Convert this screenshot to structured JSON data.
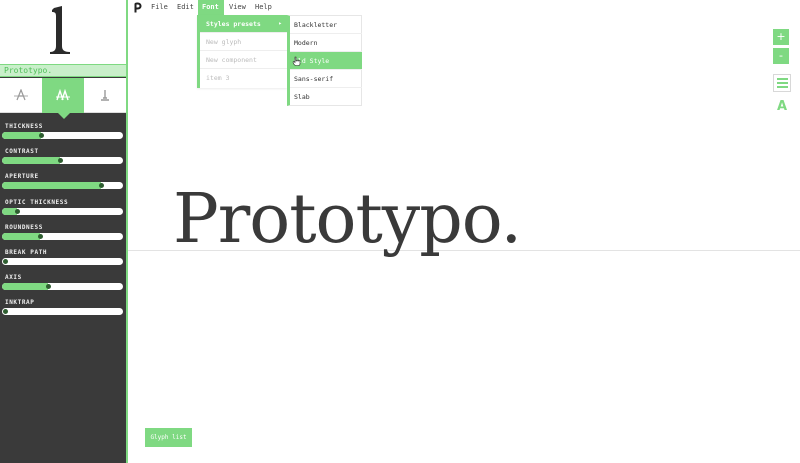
{
  "font_name": "Prototypo.",
  "preview_text": "Prototypo.",
  "menubar": {
    "items": [
      "File",
      "Edit",
      "Font",
      "View",
      "Help"
    ],
    "active": "Font"
  },
  "dropdown": {
    "items": [
      "Styles presets",
      "New glyph",
      "New component",
      "item 3"
    ],
    "active_index": 0,
    "arrow": "▸"
  },
  "submenu": {
    "items": [
      "Blackletter",
      "Modern",
      "Old Style",
      "Sans-serif",
      "Slab"
    ],
    "hovered_index": 2
  },
  "parameters": [
    {
      "label": "THICKNESS",
      "value": "",
      "level": 0.32
    },
    {
      "label": "CONTRAST",
      "value": "",
      "level": 0.48
    },
    {
      "label": "APERTURE",
      "value": "",
      "level": 0.82
    },
    {
      "label": "OPTIC THICKNESS",
      "value": "",
      "level": 0.12
    },
    {
      "label": "ROUNDNESS",
      "value": "",
      "level": 0.31
    },
    {
      "label": "BREAK PATH",
      "value": "",
      "level": 0.0
    },
    {
      "label": "AXIS",
      "value": "",
      "level": 0.38
    },
    {
      "label": "INKTRAP",
      "value": "",
      "level": 0.0
    }
  ],
  "tools": {
    "zoom_in": "+",
    "zoom_out": "-",
    "menu_icon": "hamburger-icon",
    "font_icon": "A"
  },
  "glyph_list_label": "Glyph list",
  "colors": {
    "accent": "#7fd982",
    "panel": "#3a3a3a",
    "knob": "#2e5e30"
  }
}
